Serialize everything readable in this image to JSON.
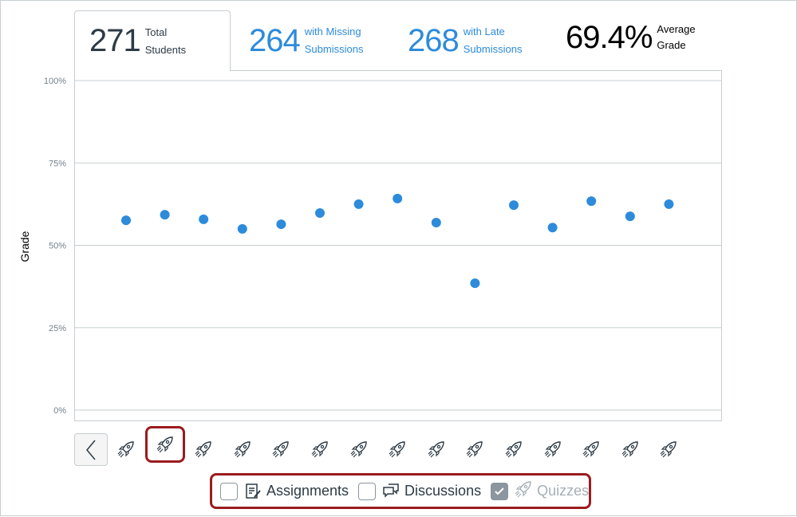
{
  "stats": [
    {
      "value": "271",
      "label1": "Total",
      "label2": "Students",
      "color": "#2d3b45",
      "active": true
    },
    {
      "value": "264",
      "label1": "with Missing",
      "label2": "Submissions",
      "color": "#2d8bdb"
    },
    {
      "value": "268",
      "label1": "with Late",
      "label2": "Submissions",
      "color": "#2d8bdb"
    },
    {
      "value": "69.4%",
      "label1": "Average",
      "label2": "Grade",
      "color": "#000000"
    }
  ],
  "chart_data": {
    "type": "scatter",
    "ylabel": "Grade",
    "ylim": [
      0,
      100
    ],
    "yticks": [
      "0%",
      "25%",
      "50%",
      "75%",
      "100%"
    ],
    "grid": true,
    "point_color": "#2d8bdb",
    "x": [
      1,
      2,
      3,
      4,
      5,
      6,
      7,
      8,
      9,
      10,
      11,
      12,
      13,
      14,
      15
    ],
    "values": [
      57.6,
      59.3,
      57.9,
      55.0,
      56.4,
      59.8,
      62.5,
      64.2,
      56.9,
      38.5,
      62.2,
      55.4,
      63.4,
      58.8,
      62.5
    ]
  },
  "x_icons": {
    "icon": "rocket-icon",
    "count": 15,
    "selected_index": 1
  },
  "filters": [
    {
      "label": "Assignments",
      "icon": "assignment-icon",
      "checked": false
    },
    {
      "label": "Discussions",
      "icon": "discussion-icon",
      "checked": false
    },
    {
      "label": "Quizzes",
      "icon": "rocket-icon",
      "checked": true
    }
  ],
  "highlight_color": "#9b1b1e"
}
